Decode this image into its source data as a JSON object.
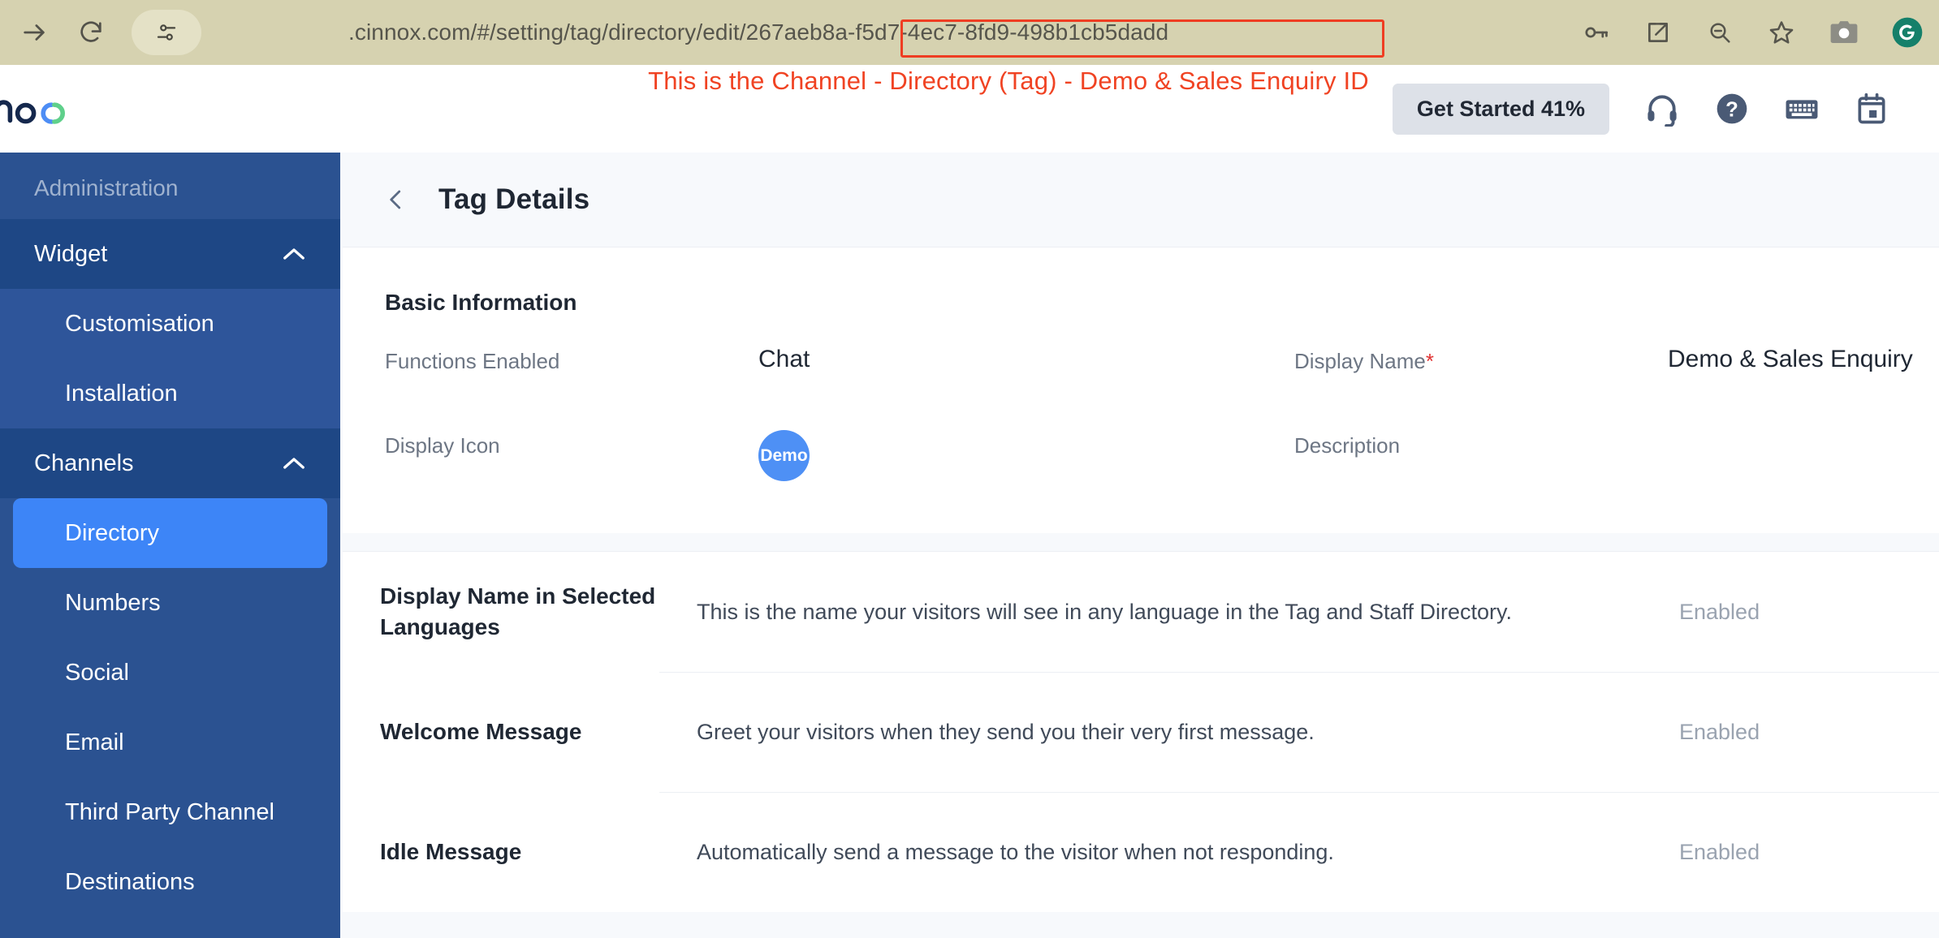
{
  "browser": {
    "url_prefix": ".cinnox.com/#/setting/tag/directory/edit/",
    "url_id": "267aeb8a-f5d7-4ec7-8fd9-498b1cb5dadd",
    "full_url": ".cinnox.com/#/setting/tag/directory/edit/267aeb8a-f5d7-4ec7-8fd9-498b1cb5dadd",
    "highlight_color": "#ef3d22",
    "icons": {
      "forward": "forward-arrow-icon",
      "reload": "reload-icon",
      "site_info": "site-settings-icon",
      "password": "key-icon",
      "share": "share-external-icon",
      "zoom_out": "zoom-out-icon",
      "bookmark": "star-icon",
      "screenshot": "camera-icon",
      "grammarly": "grammarly-icon"
    }
  },
  "annotation": {
    "text": "This is the Channel - Directory (Tag) - Demo & Sales Enquiry ID",
    "color": "#f04323"
  },
  "app_header": {
    "logo_text": "nnox",
    "get_started_label": "Get Started 41%",
    "progress_percent": "41%",
    "icons": [
      {
        "name": "headset-icon"
      },
      {
        "name": "help-icon"
      },
      {
        "name": "keyboard-icon"
      },
      {
        "name": "calendar-icon"
      }
    ]
  },
  "sidebar": {
    "section_title": "Administration",
    "groups": [
      {
        "label": "Widget",
        "expanded": true,
        "items": [
          {
            "label": "Customisation",
            "active": false
          },
          {
            "label": "Installation",
            "active": false
          }
        ]
      },
      {
        "label": "Channels",
        "expanded": true,
        "items": [
          {
            "label": "Directory",
            "active": true
          },
          {
            "label": "Numbers",
            "active": false
          },
          {
            "label": "Social",
            "active": false
          },
          {
            "label": "Email",
            "active": false
          },
          {
            "label": "Third Party Channel",
            "active": false
          },
          {
            "label": "Destinations",
            "active": false
          }
        ]
      }
    ]
  },
  "main": {
    "page_title": "Tag Details",
    "basic_information": {
      "title": "Basic Information",
      "functions_enabled_label": "Functions Enabled",
      "functions_enabled_value": "Chat",
      "display_name_label": "Display Name",
      "display_name_required": "*",
      "display_name_value": "Demo & Sales Enquiry",
      "display_icon_label": "Display Icon",
      "display_icon_text": "Demo",
      "display_icon_color": "#4e90f5",
      "description_label": "Description",
      "description_value": ""
    },
    "settings": [
      {
        "label": "Display Name in Selected Languages",
        "description": "This is the name your visitors will see in any language in the Tag and Staff Directory.",
        "state": "Enabled"
      },
      {
        "label": "Welcome Message",
        "description": "Greet your visitors when they send you their very first message.",
        "state": "Enabled"
      },
      {
        "label": "Idle Message",
        "description": "Automatically send a message to the visitor when not responding.",
        "state": "Enabled"
      }
    ]
  }
}
